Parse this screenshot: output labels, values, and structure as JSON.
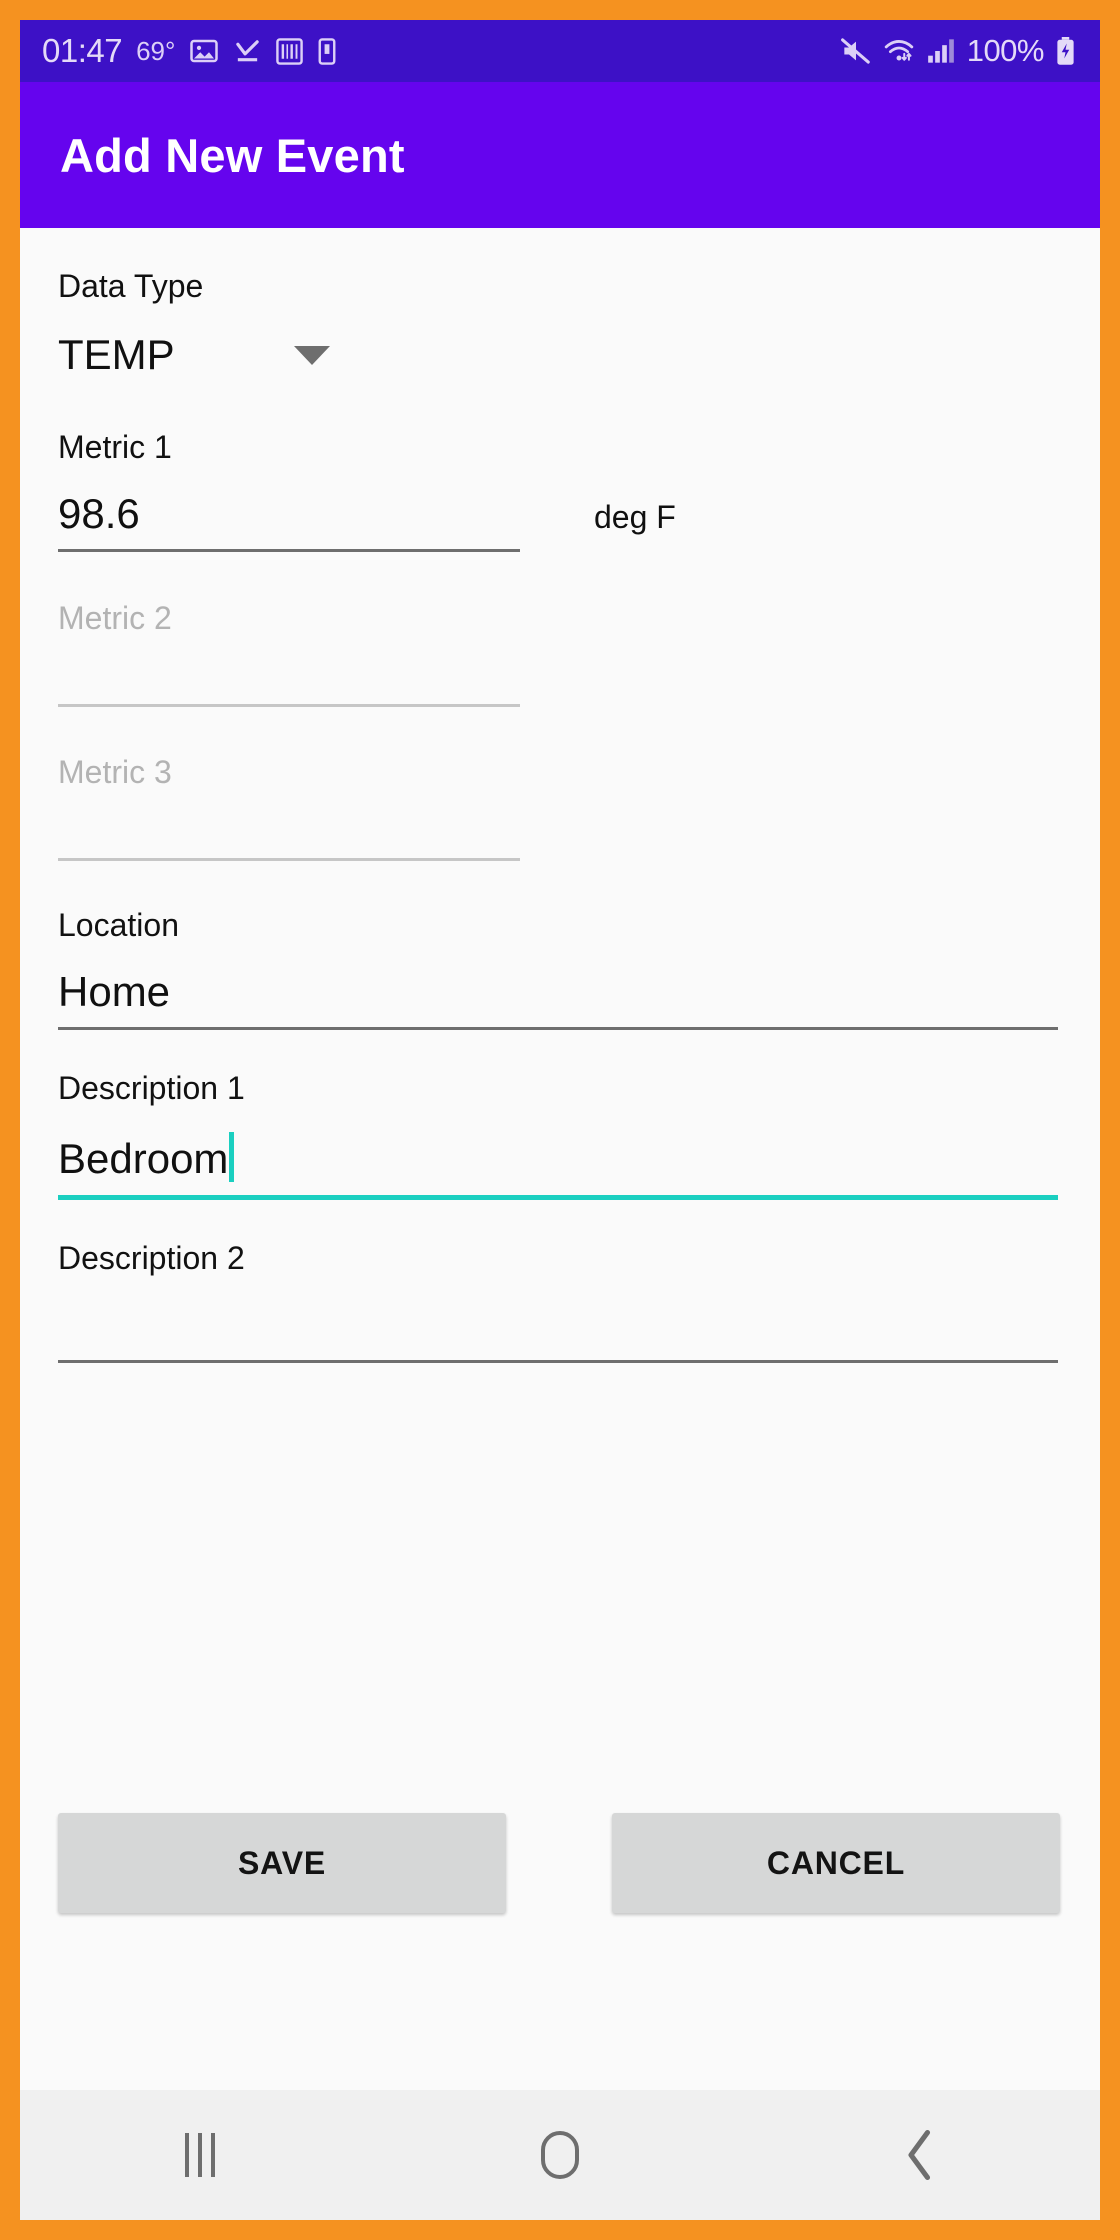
{
  "status_bar": {
    "time": "01:47",
    "temperature": "69°",
    "battery_percent": "100%",
    "icons": [
      "gallery-icon",
      "check-download-icon",
      "barcode-icon",
      "sim-card-icon",
      "mute-icon",
      "wifi-icon",
      "signal-icon",
      "battery-charging-icon"
    ]
  },
  "app_bar": {
    "title": "Add New Event"
  },
  "form": {
    "data_type": {
      "label": "Data Type",
      "value": "TEMP",
      "options": [
        "TEMP"
      ]
    },
    "metric1": {
      "label": "Metric 1",
      "value": "98.6",
      "unit": "deg F"
    },
    "metric2": {
      "label": "",
      "placeholder": "Metric 2",
      "value": ""
    },
    "metric3": {
      "label": "",
      "placeholder": "Metric 3",
      "value": ""
    },
    "location": {
      "label": "Location",
      "value": "Home"
    },
    "description1": {
      "label": "Description 1",
      "value": "Bedroom",
      "focused": true
    },
    "description2": {
      "label": "Description 2",
      "value": ""
    }
  },
  "buttons": {
    "save": "SAVE",
    "cancel": "CANCEL"
  },
  "nav_bar": {
    "recents": "recents-icon",
    "home": "home-icon",
    "back": "back-icon"
  },
  "colors": {
    "frame": "#F59220",
    "status_bar": "#3D11C6",
    "app_bar": "#6504EE",
    "content_bg": "#FAFAFA",
    "accent_focus": "#1ACFC0",
    "button_bg": "#D6D7D7",
    "nav_bg": "#F0F0F0"
  }
}
